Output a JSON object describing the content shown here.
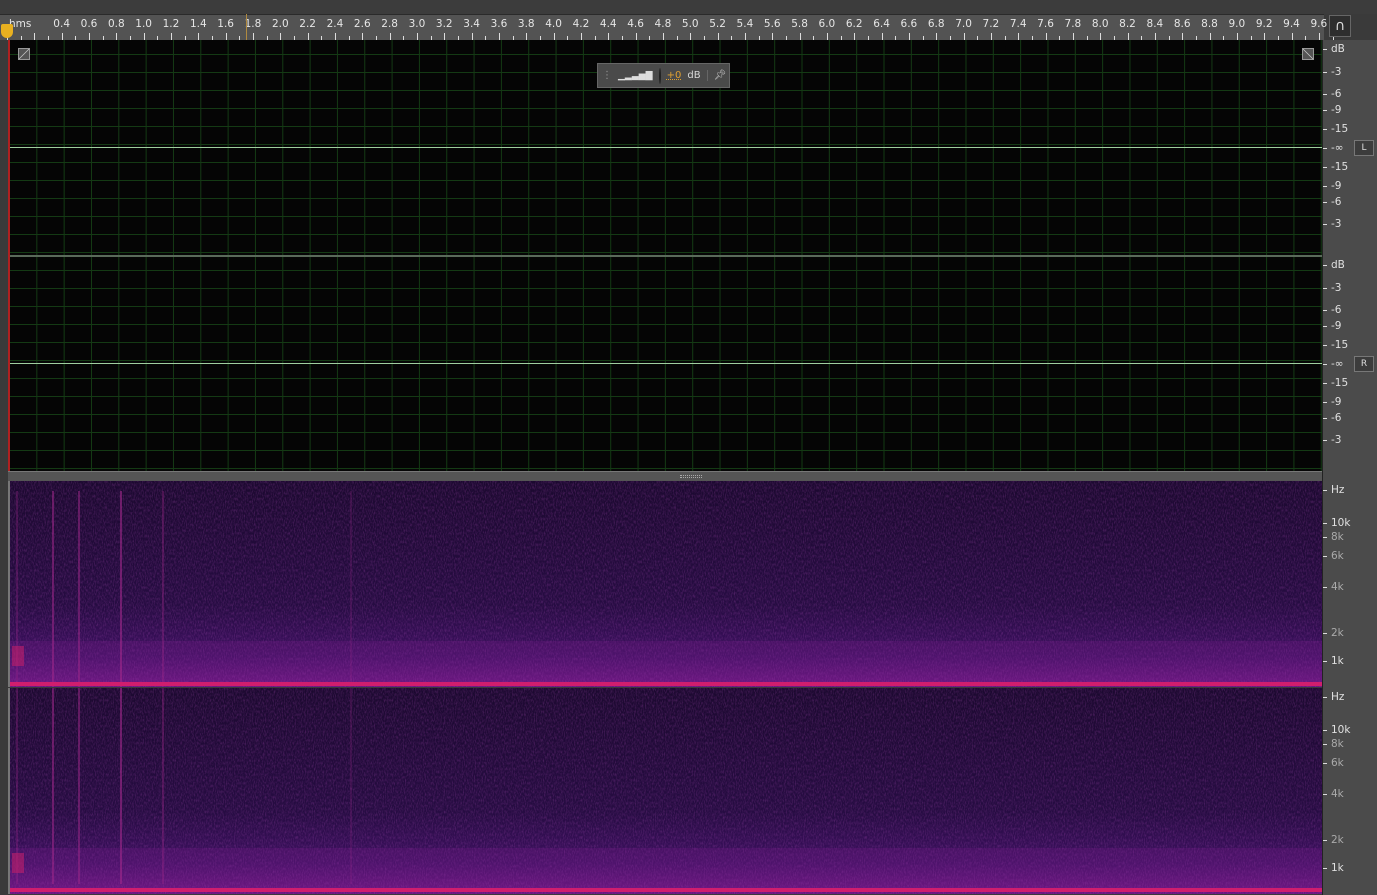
{
  "ruler": {
    "unit": "hms",
    "labels": [
      "0.4",
      "0.6",
      "0.8",
      "1.0",
      "1.2",
      "1.4",
      "1.6",
      "1.8",
      "2.0",
      "2.2",
      "2.4",
      "2.6",
      "2.8",
      "3.0",
      "3.2",
      "3.4",
      "3.6",
      "3.8",
      "4.0",
      "4.2",
      "4.4",
      "4.6",
      "4.8",
      "5.0",
      "5.2",
      "5.4",
      "5.6",
      "5.8",
      "6.0",
      "6.2",
      "6.4",
      "6.6",
      "6.8",
      "7.0",
      "7.2",
      "7.4",
      "7.6",
      "7.8",
      "8.0",
      "8.2",
      "8.4",
      "8.6",
      "8.8",
      "9.0",
      "9.2",
      "9.4",
      "9.6"
    ],
    "playhead_seconds": 1.75
  },
  "hud": {
    "value": "+0",
    "unit": "dB"
  },
  "amp_scale": {
    "unit": "dB",
    "labels": [
      "-3",
      "-6",
      "-9",
      "-15",
      "-∞",
      "-15",
      "-9",
      "-6",
      "-3"
    ]
  },
  "channels": [
    {
      "label": "L"
    },
    {
      "label": "R"
    }
  ],
  "freq_scale": {
    "unit": "Hz",
    "labels": [
      "10k",
      "8k",
      "6k",
      "4k",
      "2k",
      "1k"
    ]
  },
  "icons": {
    "snap": "magnet-icon",
    "hud_grip": "grip-icon",
    "hud_meter": "level-meter-icon",
    "hud_knob": "volume-knob-icon",
    "hud_pin": "pin-icon",
    "corner": "fade-handle-icon"
  },
  "colors": {
    "waveform": "#9fcf9f",
    "grid": "#143a14",
    "spectrum_low": "#1e0a33",
    "spectrum_high": "#d01e6e",
    "playhead": "#e8b020"
  }
}
